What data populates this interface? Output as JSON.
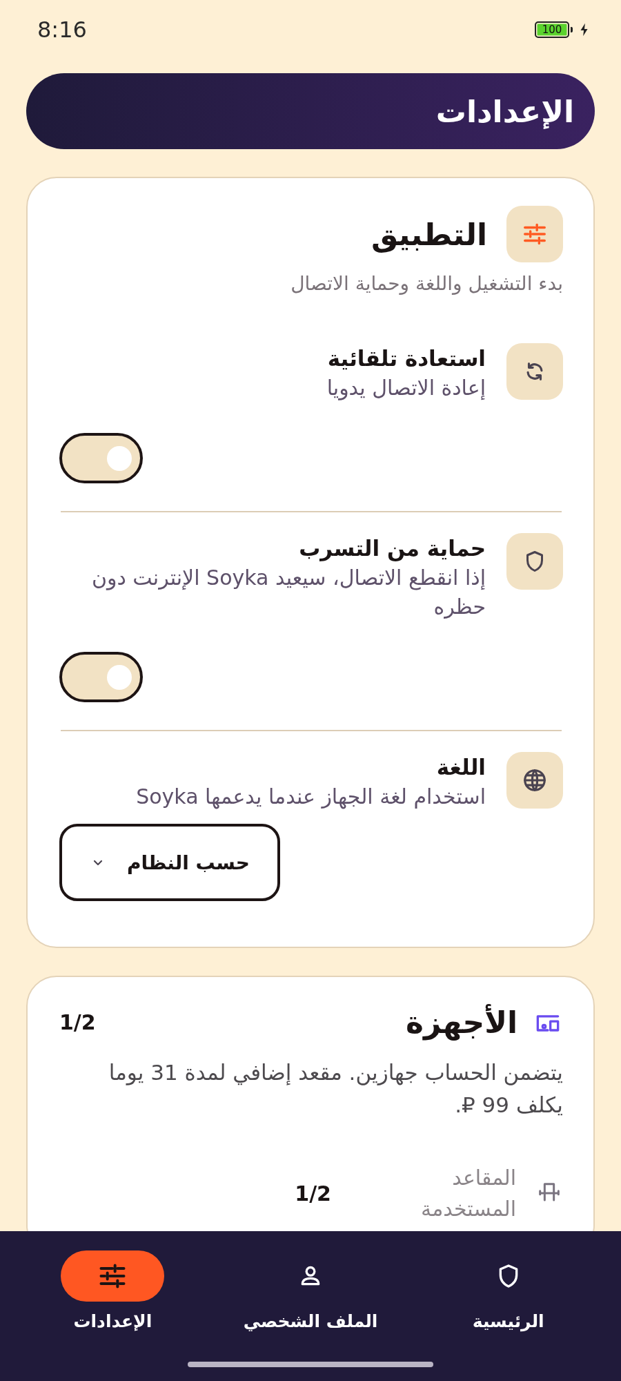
{
  "status_bar": {
    "time": "8:16",
    "battery": "100",
    "charging": true
  },
  "header": {
    "title": "الإعدادات"
  },
  "sections": [
    {
      "kind": "settings",
      "title": "التطبيق",
      "subtitle": "بدء التشغيل واللغة وحماية الاتصال",
      "rows": [
        {
          "kind": "toggle",
          "title": "استعادة تلقائية",
          "subtitle": "إعادة الاتصال يدويا",
          "on": false
        },
        {
          "kind": "toggle",
          "title": "حماية من التسرب",
          "subtitle": "إذا انقطع الاتصال، سيعيد Soyka الإنترنت دون حظره",
          "on": false
        },
        {
          "kind": "dropdown",
          "title": "اللغة",
          "subtitle": "استخدام لغة الجهاز عندما يدعمها Soyka",
          "value": "حسب النظام"
        }
      ]
    },
    {
      "kind": "devices",
      "title": "الأجهزة",
      "count": "1/2",
      "description": "يتضمن الحساب جهازين. مقعد إضافي لمدة 31 يوما يكلف 99 ₽.",
      "stats": [
        {
          "label": "المقاعد المستخدمة",
          "value": "1/2"
        }
      ]
    }
  ],
  "nav": [
    {
      "label": "الرئيسية",
      "selected": false
    },
    {
      "label": "الملف الشخصي",
      "selected": false
    },
    {
      "label": "الإعدادات",
      "selected": true
    }
  ]
}
